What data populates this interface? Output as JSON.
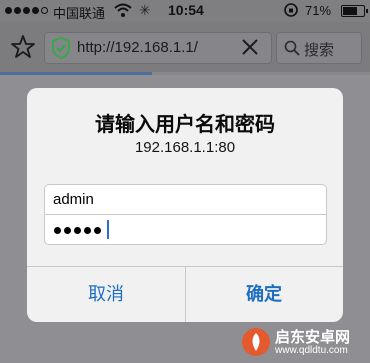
{
  "status_bar": {
    "carrier": "中国联通",
    "time": "10:54",
    "battery_percent": "71%",
    "battery_level": 0.71,
    "signal_bars_filled": 4,
    "signal_bars_total": 5
  },
  "browser": {
    "url": "http://192.168.1.1/",
    "search_label": "搜索",
    "load_progress": 0.41,
    "secure_icon_color": "#35a84a"
  },
  "dialog": {
    "title": "请输入用户名和密码",
    "host": "192.168.1.1:80",
    "username": "admin",
    "password_length": 5,
    "cancel_label": "取消",
    "confirm_label": "确定",
    "button_color": "#1f6fc0"
  },
  "watermark": {
    "name": "启东安卓网",
    "url": "www.qdldtu.com"
  }
}
